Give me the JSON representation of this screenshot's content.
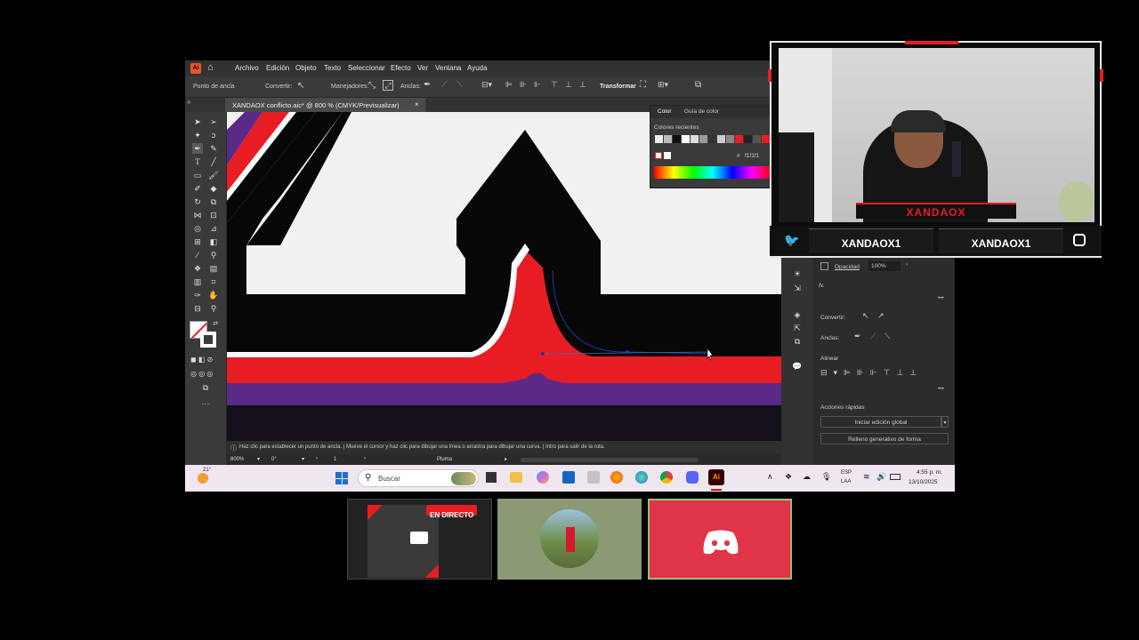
{
  "app": {
    "logo": "Ai",
    "menu": [
      "Archivo",
      "Edición",
      "Objeto",
      "Texto",
      "Seleccionar",
      "Efecto",
      "Ver",
      "Ventana",
      "Ayuda"
    ]
  },
  "control_bar": {
    "anchor_label": "Punto de ancla",
    "convert_label": "Convertir:",
    "handles_label": "Manejadores:",
    "anchors_label": "Anclas:",
    "transform_label": "Transformar"
  },
  "document_tab": {
    "title": "XANDAOX conflicto.aic* @ 800 % (CMYK/Previsualizar)",
    "close": "×"
  },
  "color_panel": {
    "tab_color": "Color",
    "tab_guide": "Guía de color",
    "recent_label": "Colores recientes",
    "hex": "f1f1f1",
    "hash": "#"
  },
  "status": {
    "hint": "Haz clic para establecer un punto de ancla. | Mueve el cursor y haz clic para dibujar una línea o arrastra para dibujar una curva. | Intro para salir de la ruta.",
    "zoom": "800%",
    "angle": "0°",
    "artboard": "1",
    "tool": "Pluma"
  },
  "properties": {
    "opacity_label": "Opacidad",
    "opacity_value": "100%",
    "fx": "fx.",
    "convert_label": "Convertir:",
    "anchors_label": "Anclas:",
    "align_label": "Alinear",
    "quick_actions": "Acciones rápidas",
    "global_edit": "Iniciar edición global",
    "generative_fill": "Relleno generativo de forma",
    "more": "•••"
  },
  "taskbar": {
    "weather": "21°",
    "search_placeholder": "Buscar",
    "lang_top": "ESP",
    "lang_bottom": "LAA",
    "time": "4:55 p. m.",
    "date": "13/10/2025"
  },
  "stream": {
    "brand": "XANDAOX",
    "twitter_handle": "XANDAOX1",
    "instagram_handle": "XANDAOX1",
    "live_badge": "EN DIRECTO"
  },
  "colors": {
    "red": "#e81c23",
    "purple": "#5b2a86",
    "black": "#070707",
    "offwhite": "#f1f1f1",
    "discord": "#e03448"
  }
}
